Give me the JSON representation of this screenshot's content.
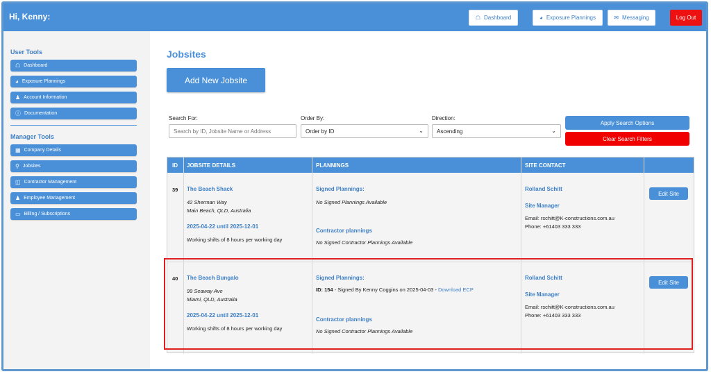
{
  "header": {
    "greeting": "Hi, Kenny:",
    "nav": [
      {
        "label": "Dashboard",
        "icon": "dashboard-icon"
      },
      {
        "label": "Exposure Plannings",
        "icon": "gauge-icon"
      },
      {
        "label": "Messaging",
        "icon": "envelope-icon"
      }
    ],
    "logout_label": "Log Out",
    "accent": "#4a90d9",
    "danger": "#ee1111"
  },
  "sidebar": {
    "user_tools_title": "User Tools",
    "user_items": [
      {
        "label": "Dashboard",
        "icon": "dashboard-icon"
      },
      {
        "label": "Exposure Plannings",
        "icon": "gauge-icon"
      },
      {
        "label": "Account Information",
        "icon": "user-icon"
      },
      {
        "label": "Documentation",
        "icon": "info-icon"
      }
    ],
    "manager_tools_title": "Manager Tools",
    "manager_items": [
      {
        "label": "Company Details",
        "icon": "building-icon"
      },
      {
        "label": "Jobsites",
        "icon": "map-marker-icon"
      },
      {
        "label": "Contractor Management",
        "icon": "briefcase-icon"
      },
      {
        "label": "Employee Management",
        "icon": "users-icon"
      },
      {
        "label": "Billing / Subscriptions",
        "icon": "credit-card-icon"
      }
    ]
  },
  "main": {
    "title": "Jobsites",
    "add_button": "Add New Jobsite",
    "search": {
      "search_label": "Search For:",
      "search_placeholder": "Search by ID, Jobsite Name or Address",
      "order_label": "Order By:",
      "order_value": "Order by ID",
      "direction_label": "Direction:",
      "direction_value": "Ascending",
      "apply_label": "Apply Search Options",
      "clear_label": "Clear Search Filters"
    },
    "table": {
      "headers": [
        "ID",
        "JOBSITE DETAILS",
        "PLANNINGS",
        "SITE CONTACT"
      ],
      "rows": [
        {
          "id": "39",
          "name": "The Beach Shack",
          "address1": "42 Sherman Way",
          "address2": "Main Beach, QLD, Australia",
          "dates": "2025-04-22 until 2025-12-01",
          "shifts": "Working shifts of 8 hours per working day",
          "signed_title": "Signed Plannings:",
          "signed_text": "No Signed Plannings Available",
          "signed_id_label": "",
          "signed_id": "",
          "signed_by": "",
          "signed_link": "",
          "contractor_title": "Contractor plannings",
          "contractor_text": "No Signed Contractor Plannings Available",
          "contact_name": "Rolland Schitt",
          "contact_role": "Site Manager",
          "email": "Email: rschitt@K-constructions.com.au",
          "phone": "Phone: +61403 333 333",
          "edit_label": "Edit Site"
        },
        {
          "id": "40",
          "name": "The Beach Bungalo",
          "address1": "99 Seaway Ave",
          "address2": "Miami, QLD, Australia",
          "dates": "2025-04-22 until 2025-12-01",
          "shifts": "Working shifts of 8 hours per working day",
          "signed_title": "Signed Plannings:",
          "signed_text": "",
          "signed_id_label": "ID: 154",
          "signed_id": "ID: 154",
          "signed_by": " - Signed By Kenny Coggins on 2025-04-03 - ",
          "signed_link": "Download ECP",
          "contractor_title": "Contractor plannings",
          "contractor_text": "No Signed Contractor Plannings Available",
          "contact_name": "Rolland Schitt",
          "contact_role": "Site Manager",
          "email": "Email: rschitt@K-constructions.com.au",
          "phone": "Phone: +61403 333 333",
          "edit_label": "Edit Site"
        }
      ]
    },
    "highlight_color": "#e01e1e"
  }
}
